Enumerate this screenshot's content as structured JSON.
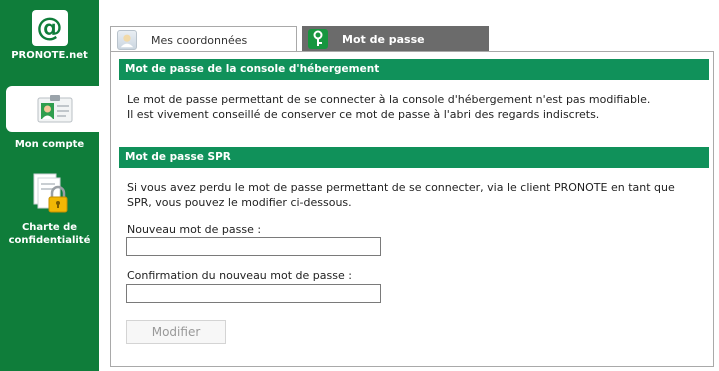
{
  "sidebar": {
    "items": [
      {
        "label": "PRONOTE.net",
        "icon": "at-sign-icon"
      },
      {
        "label": "Mon compte",
        "icon": "id-card-icon",
        "selected": true
      },
      {
        "label_line1": "Charte de",
        "label_line2": "confidentialité",
        "icon": "document-lock-icon"
      }
    ],
    "colors": {
      "background": "#0f7d3a"
    }
  },
  "tabs": [
    {
      "label": "Mes coordonnées",
      "active": false
    },
    {
      "label": "Mot de passe",
      "active": true
    }
  ],
  "sections": {
    "hosting": {
      "title": "Mot de passe de la console d'hébergement",
      "line1": "Le mot de passe permettant de se connecter à la console d'hébergement n'est pas modifiable.",
      "line2": "Il est vivement conseillé de conserver ce mot de passe à l'abri des regards indiscrets."
    },
    "spr": {
      "title": "Mot de passe SPR",
      "line1": "Si vous avez perdu le mot de passe permettant de se connecter, via le client PRONOTE en tant que",
      "line2": "SPR, vous pouvez le modifier ci-dessous.",
      "new_label": "Nouveau mot de passe :",
      "new_value": "",
      "confirm_label": "Confirmation du nouveau mot de passe :",
      "confirm_value": "",
      "button_label": "Modifier"
    }
  },
  "colors": {
    "section_bar": "#10915a",
    "active_tab": "#6b6b6b"
  }
}
